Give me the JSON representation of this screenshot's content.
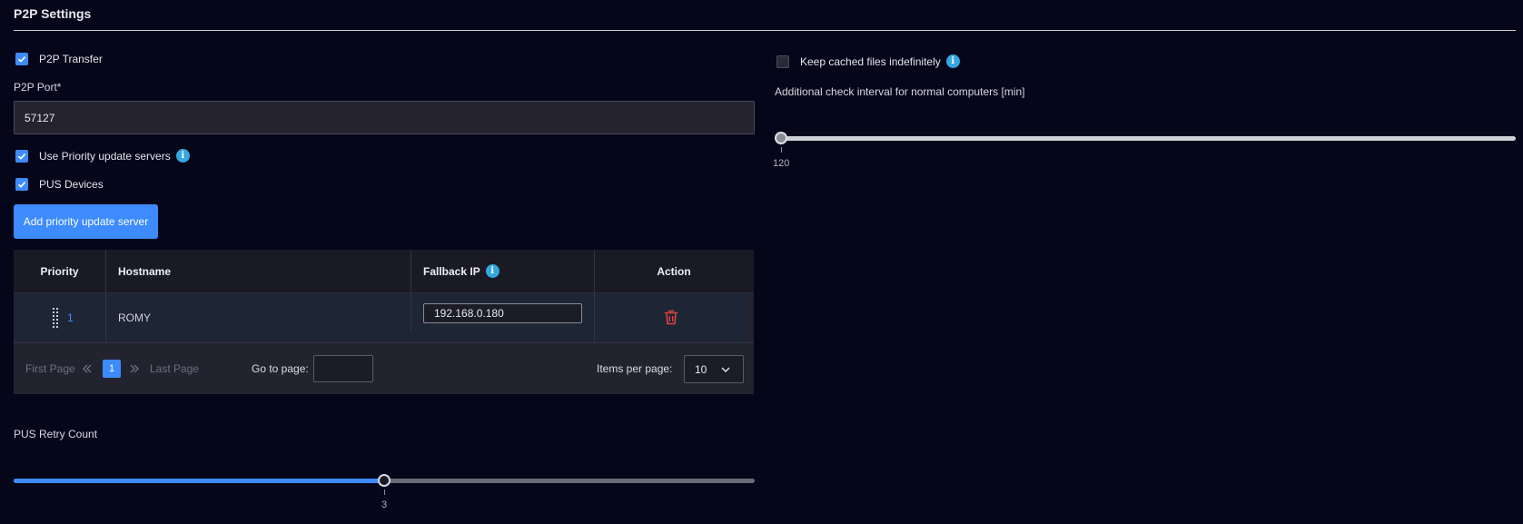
{
  "section": {
    "title": "P2P Settings"
  },
  "left": {
    "p2p_transfer": {
      "label": "P2P Transfer",
      "checked": true
    },
    "p2p_port": {
      "label": "P2P Port*",
      "value": "57127"
    },
    "use_priority": {
      "label": "Use Priority update servers",
      "checked": true
    },
    "pus_devices": {
      "label": "PUS Devices",
      "checked": true
    },
    "add_button": "Add priority update server",
    "table": {
      "headers": {
        "priority": "Priority",
        "hostname": "Hostname",
        "fallback_ip": "Fallback IP",
        "action": "Action"
      },
      "rows": [
        {
          "priority": "1",
          "hostname": "ROMY",
          "fallback_ip": "192.168.0.180"
        }
      ]
    },
    "pager": {
      "first": "First Page",
      "last": "Last Page",
      "current_page": "1",
      "goto_label": "Go to page:",
      "items_label": "Items per page:",
      "items_value": "10"
    },
    "retry": {
      "label": "PUS Retry Count",
      "value": "3",
      "fraction": 0.5
    }
  },
  "right": {
    "keep_cached": {
      "label": "Keep cached files indefinitely",
      "checked": false
    },
    "interval": {
      "label": "Additional check interval for normal computers [min]",
      "value": "120",
      "fraction": 0
    }
  },
  "colors": {
    "accent": "#3d8bfd",
    "info": "#35a6de",
    "danger": "#e2403f",
    "background": "#06061a"
  },
  "icons": [
    "check-icon",
    "info-icon",
    "drag-handle-icon",
    "trash-icon",
    "double-chevron-left-icon",
    "double-chevron-right-icon",
    "chevron-down-icon"
  ]
}
